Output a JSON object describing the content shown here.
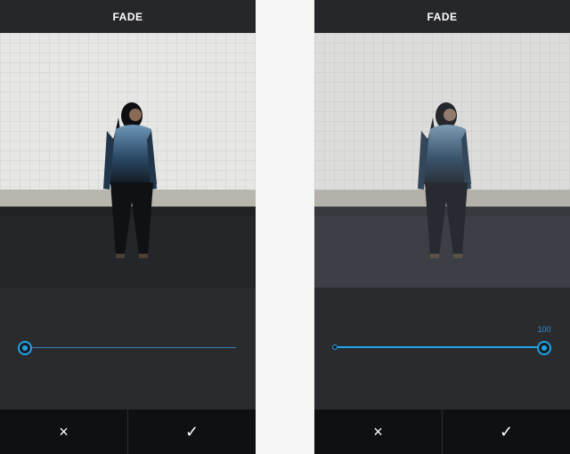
{
  "screens": [
    {
      "header": {
        "title": "FADE"
      },
      "slider": {
        "value": 0,
        "value_label": ""
      },
      "actions": {
        "cancel_icon": "×",
        "confirm_icon": "✓"
      },
      "icons": {
        "cancel": "close-icon",
        "confirm": "checkmark-icon"
      }
    },
    {
      "header": {
        "title": "FADE"
      },
      "slider": {
        "value": 100,
        "value_label": "100"
      },
      "actions": {
        "cancel_icon": "×",
        "confirm_icon": "✓"
      },
      "icons": {
        "cancel": "close-icon",
        "confirm": "checkmark-icon"
      }
    }
  ],
  "colors": {
    "accent": "#1fa4e8",
    "panel": "#2a2b2f",
    "action_bar": "#0f1012"
  }
}
